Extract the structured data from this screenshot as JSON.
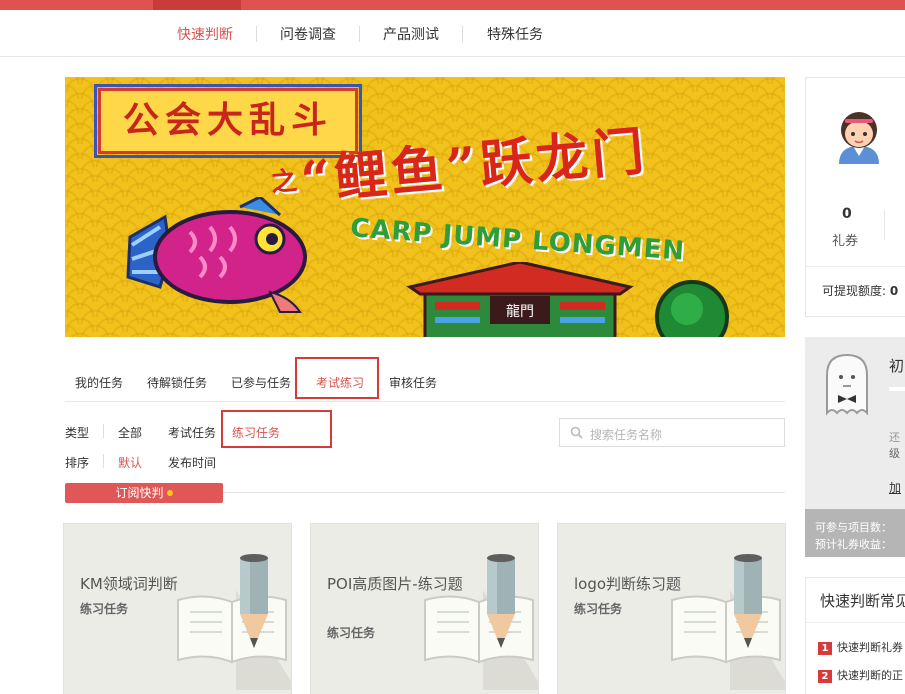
{
  "nav": {
    "items": [
      {
        "label": "快速判断",
        "active": true
      },
      {
        "label": "问卷调查",
        "active": false
      },
      {
        "label": "产品测试",
        "active": false
      },
      {
        "label": "特殊任务",
        "active": false
      }
    ]
  },
  "banner": {
    "title": "公会大乱斗",
    "subtitle_prefix": "之",
    "subtitle": "“鲤鱼”跃龙门",
    "english": "CARP JUMP LONGMEN",
    "gate_sign": "龍門"
  },
  "tabs": [
    {
      "label": "我的任务",
      "active": false
    },
    {
      "label": "待解锁任务",
      "active": false
    },
    {
      "label": "已参与任务",
      "active": false
    },
    {
      "label": "考试练习",
      "active": true
    },
    {
      "label": "审核任务",
      "active": false
    }
  ],
  "filters": {
    "type_label": "类型",
    "type_options": [
      "全部",
      "考试任务",
      "练习任务"
    ],
    "type_selected": "练习任务",
    "sort_label": "排序",
    "sort_options": [
      "默认",
      "发布时间"
    ],
    "sort_selected": "默认"
  },
  "search": {
    "placeholder": "搜索任务名称",
    "icon": "search-icon"
  },
  "subscribe": {
    "label": "订阅快判"
  },
  "cards": [
    {
      "title": "KM领域词判断",
      "tag": "练习任务"
    },
    {
      "title": "POI高质图片-练习题",
      "tag": "练习任务"
    },
    {
      "title": "logo判断练习题",
      "tag": "练习任务"
    }
  ],
  "profile": {
    "coupon_count": "0",
    "coupon_label": "礼券",
    "withdraw_label": "可提现额度:",
    "withdraw_value": "0"
  },
  "level_card": {
    "level_prefix": "初",
    "line1": "还",
    "line2": "级",
    "link": "加",
    "projects_label": "可参与项目数：",
    "earnings_label": "预计礼券收益："
  },
  "faq": {
    "title": "快速判断常见",
    "items": [
      {
        "num": "1",
        "text": "快速判断礼券"
      },
      {
        "num": "2",
        "text": "快速判断的正"
      }
    ]
  },
  "colors": {
    "accent": "#d9534f",
    "topbar": "#e05252",
    "banner_bg": "#f2c21c"
  }
}
